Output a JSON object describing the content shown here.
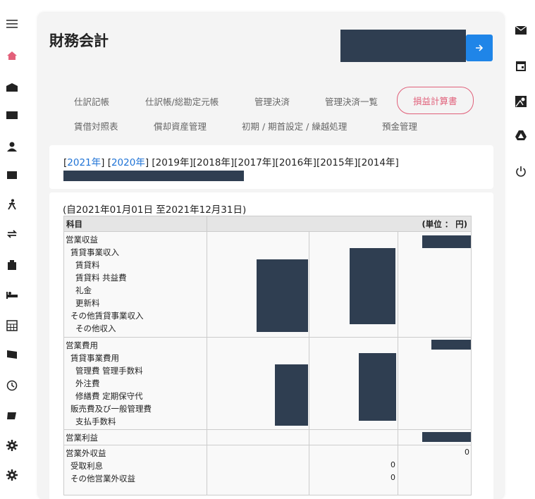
{
  "left_nav": {
    "icons": [
      "menu-icon",
      "home-icon",
      "mail-open-icon",
      "mail-icon",
      "person-icon",
      "wallet-icon",
      "walking-person-icon",
      "transfer-icon",
      "building-icon",
      "bed-icon",
      "calculator-icon",
      "flag-icon",
      "clock-icon",
      "book-icon",
      "gear-icon",
      "gear-icon"
    ],
    "colors": {
      "home": "#e3607a",
      "default": "#222222"
    }
  },
  "right_nav": {
    "icons": [
      "mail-icon",
      "calendar-icon",
      "map-icon",
      "drive-icon",
      "power-icon"
    ]
  },
  "header": {
    "title": "財務会計",
    "go_button_icon": "arrow-right-icon",
    "accent": "#1f85e8"
  },
  "tabs": {
    "row1": [
      "仕訳記帳",
      "仕訳帳/総勘定元帳",
      "管理決済",
      "管理決済一覧",
      "損益計算書"
    ],
    "row2": [
      "賃借対照表",
      "償却資産管理",
      "初期 / 期首設定 / 繰越処理",
      "預金管理"
    ],
    "active": "損益計算書",
    "active_color": "#e0607a"
  },
  "years": {
    "links": [
      "2021年",
      "2020年"
    ],
    "plain": "[2019年][2018年][2017年][2016年][2015年][2014年]",
    "link_color": "#1f73d6"
  },
  "report": {
    "period": "(自2021年01月01日 至2021年12月31日)",
    "header_subject": "科目",
    "header_unit": "(単位 ： 円)",
    "sections": [
      {
        "rows": [
          "営業収益",
          "賃貸事業収入",
          "賃貸料",
          "賃貸料 共益費",
          "礼金",
          "更新料",
          "その他賃貸事業収入",
          "その他収入"
        ]
      },
      {
        "rows": [
          "営業費用",
          "賃貸事業費用",
          "管理費 管理手数料",
          "外注費",
          "修繕費 定期保守代",
          "販売費及び一般管理費",
          "支払手数料"
        ]
      },
      {
        "rows": [
          "営業利益"
        ]
      },
      {
        "rows": [
          "営業外収益",
          "受取利息",
          "その他営業外収益"
        ]
      }
    ],
    "values": {
      "zero": "0"
    }
  }
}
